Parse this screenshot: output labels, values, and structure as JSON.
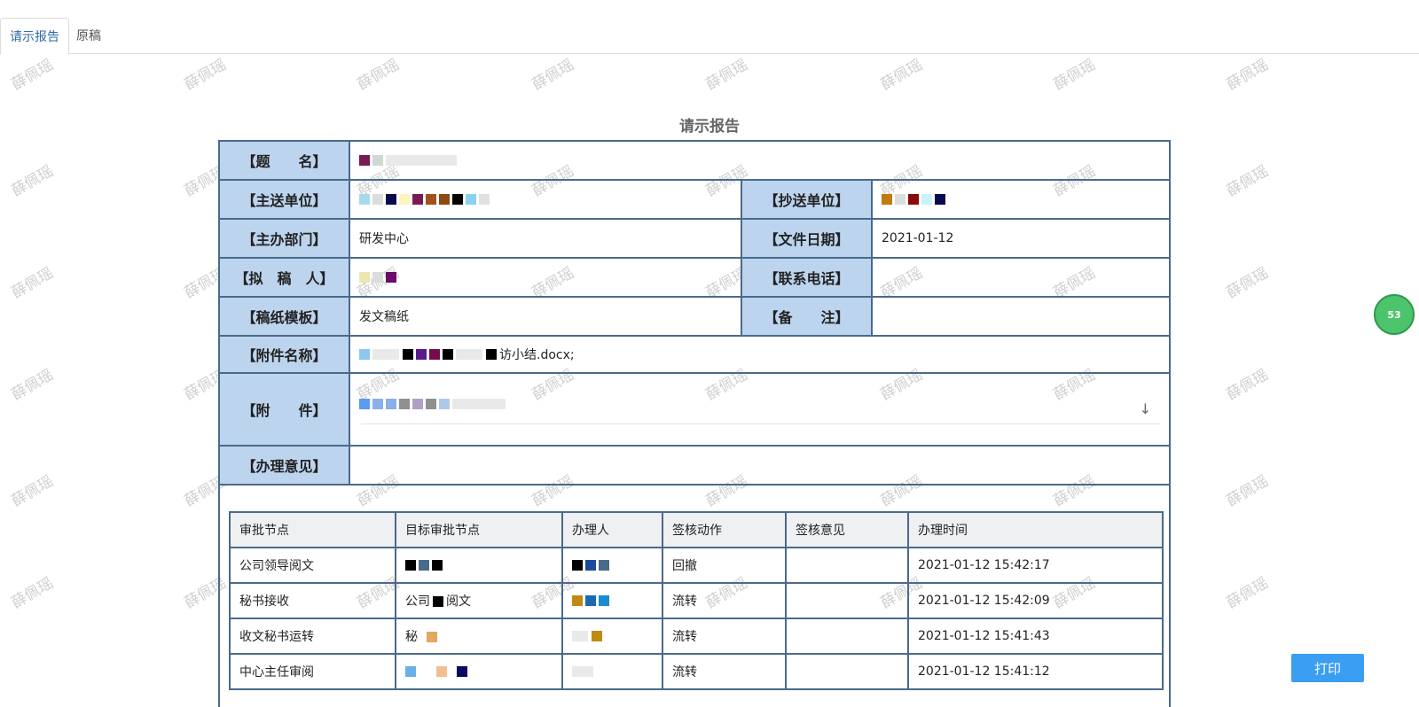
{
  "tabs": [
    {
      "label": "请示报告",
      "active": true
    },
    {
      "label": "原稿",
      "active": false
    }
  ],
  "watermark_text": "薛佩瑶",
  "document": {
    "title": "请示报告",
    "fields": {
      "title_label": "【题　　名】",
      "main_unit_label": "【主送单位】",
      "cc_unit_label": "【抄送单位】",
      "dept_label": "【主办部门】",
      "dept_value": "研发中心",
      "date_label": "【文件日期】",
      "date_value": "2021-01-12",
      "drafter_label": "【拟　稿　人】",
      "phone_label": "【联系电话】",
      "template_label": "【稿纸模板】",
      "template_value": "发文稿纸",
      "remark_label": "【备　　注】",
      "attach_name_label": "【附件名称】",
      "attach_name_value": "访小结.docx;",
      "attach_label": "【附　　件】",
      "opinion_label": "【办理意见】"
    }
  },
  "approval_table": {
    "headers": [
      "审批节点",
      "目标审批节点",
      "办理人",
      "签核动作",
      "签核意见",
      "办理时间"
    ],
    "rows": [
      {
        "node": "公司领导阅文",
        "target": "",
        "handler": "",
        "action": "回撤",
        "opinion": "",
        "time": "2021-01-12 15:42:17"
      },
      {
        "node": "秘书接收",
        "target": "公司",
        "target2": "阅文",
        "handler": "",
        "action": "流转",
        "opinion": "",
        "time": "2021-01-12 15:42:09"
      },
      {
        "node": "收文秘书运转",
        "target": "秘",
        "handler": "",
        "action": "流转",
        "opinion": "",
        "time": "2021-01-12 15:41:43"
      },
      {
        "node": "中心主任审阅",
        "target": "",
        "handler": "",
        "action": "流转",
        "opinion": "",
        "time": "2021-01-12 15:41:12"
      }
    ]
  },
  "print_label": "打印",
  "badge_value": "53",
  "colors": {
    "label_bg": "#bcd4ee",
    "border": "#4a6a8a",
    "accent": "#3a9ef2"
  }
}
